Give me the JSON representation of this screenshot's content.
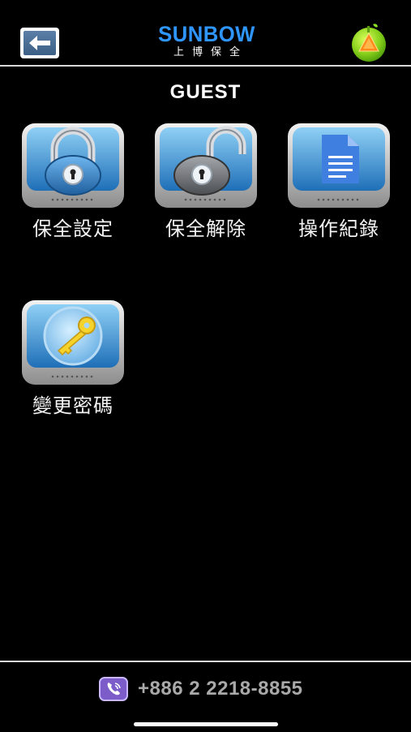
{
  "header": {
    "back_icon": "back-arrow-icon",
    "brand_name": "SUNBOW",
    "brand_sub": "上博保全",
    "globe_icon": "globe-icon"
  },
  "page": {
    "title": "GUEST"
  },
  "tiles": [
    {
      "label": "保全設定",
      "icon": "locked-padlock-icon"
    },
    {
      "label": "保全解除",
      "icon": "unlocked-padlock-icon"
    },
    {
      "label": "操作紀錄",
      "icon": "document-icon"
    },
    {
      "label": "變更密碼",
      "icon": "key-icon"
    }
  ],
  "footer": {
    "phone_icon": "phone-icon",
    "phone_number": "+886 2 2218-8855"
  },
  "colors": {
    "background": "#000000",
    "brand": "#2f95ff",
    "tile_blue": "#3c8fd6",
    "footer_text": "#a9a9a9"
  }
}
